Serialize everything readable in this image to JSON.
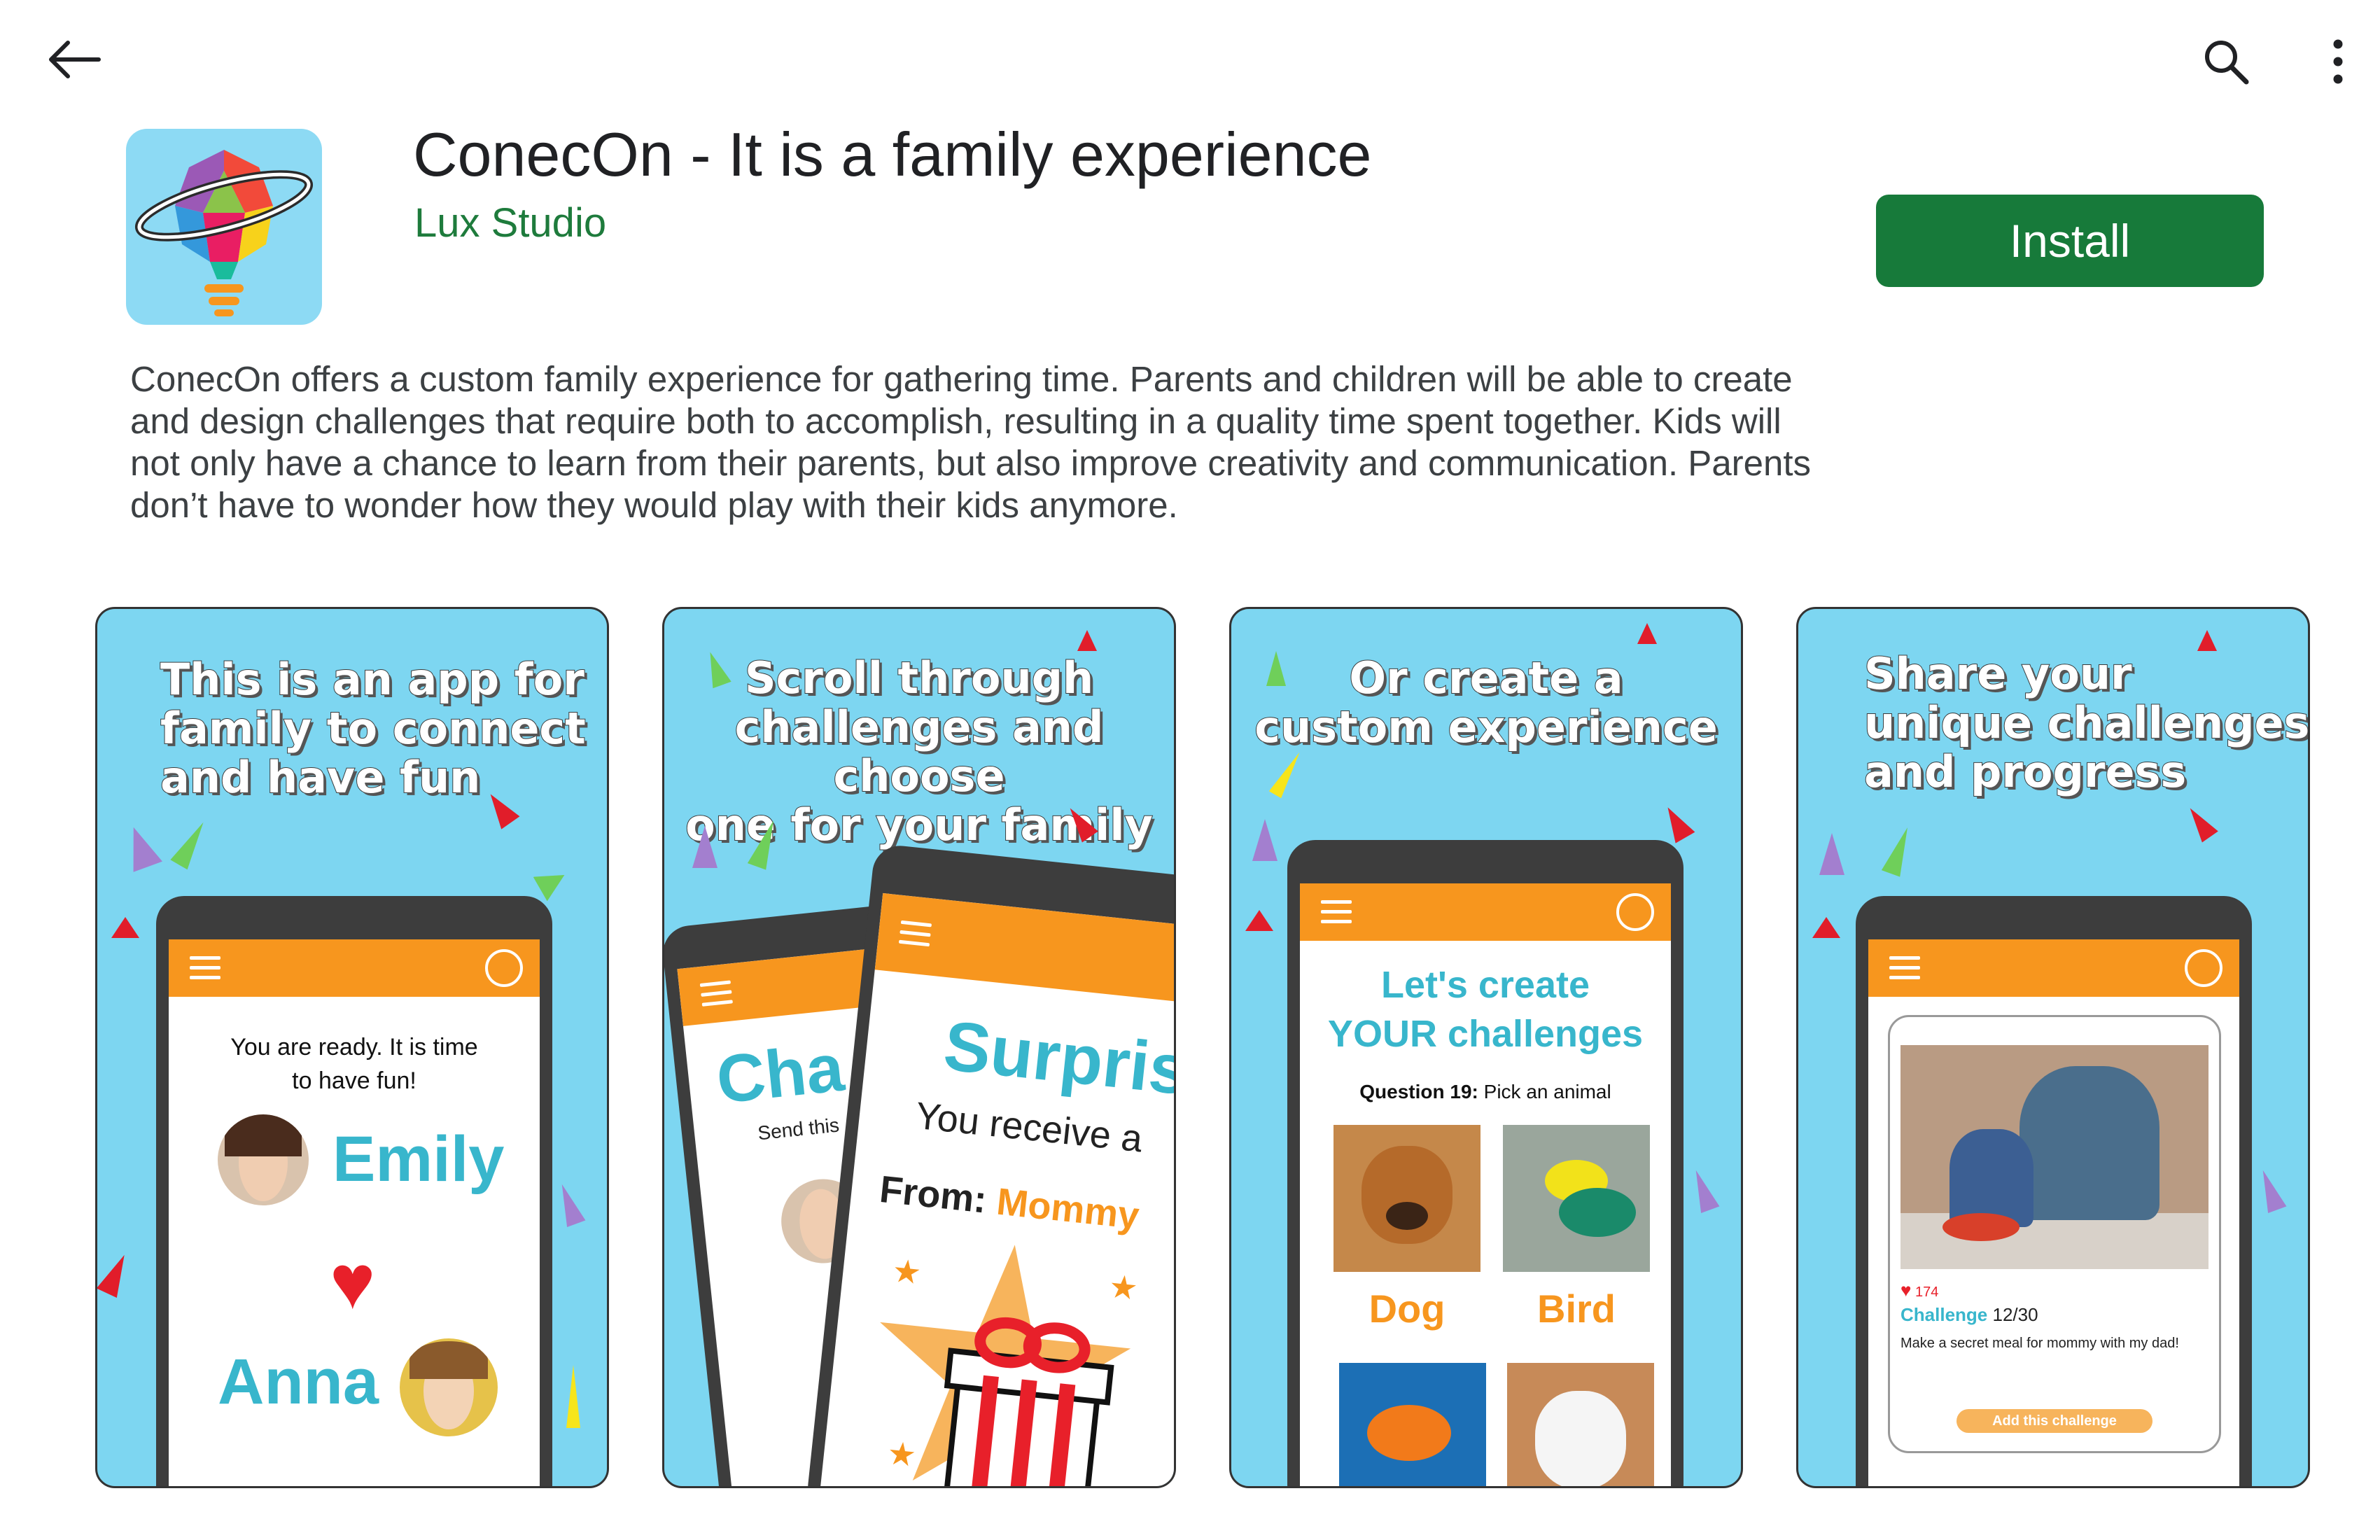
{
  "app": {
    "title": "ConecOn - It is a family experience",
    "developer": "Lux Studio",
    "install_label": "Install",
    "description": "ConecOn offers a custom family experience for gathering time. Parents and children will be able to create and design challenges that require both to accomplish, resulting in a quality time spent together. Kids will not only have a chance to learn from their parents, but also improve creativity and communication. Parents don’t have to wonder how they would play with their kids anymore."
  },
  "colors": {
    "install": "#177a3a",
    "developer": "#1e7b3c",
    "shot_bg": "#7dd6f1",
    "appbar": "#f7961e",
    "teal": "#38b6cc"
  },
  "icons": {
    "back": "arrow-left-icon",
    "search": "search-icon",
    "more": "more-vert-icon"
  },
  "screenshots": [
    {
      "caption": [
        "This is an app for",
        "family to connect",
        "and have fun"
      ],
      "message": [
        "You are ready. It is time",
        "to have fun!"
      ],
      "name1": "Emily",
      "name2": "Anna"
    },
    {
      "caption": [
        "Scroll through",
        "challenges and choose",
        "one for your family"
      ],
      "back_title": "Cha",
      "back_sub": "Send this",
      "title": "Surpris",
      "sub": "You receive a",
      "from_label": "From:",
      "from_value": "Mommy"
    },
    {
      "caption": [
        "Or create a",
        "custom experience"
      ],
      "title": [
        "Let's create",
        "YOUR challenges"
      ],
      "question_label": "Question 19:",
      "question_text": "Pick an animal",
      "options": [
        "Dog",
        "Bird"
      ]
    },
    {
      "caption": [
        "Share your",
        "unique challenges",
        "and progress"
      ],
      "likes": "174",
      "challenge_label": "Challenge",
      "challenge_count": "12/30",
      "challenge_text": "Make a secret meal for mommy with my dad!",
      "add_label": "Add this challenge"
    }
  ]
}
